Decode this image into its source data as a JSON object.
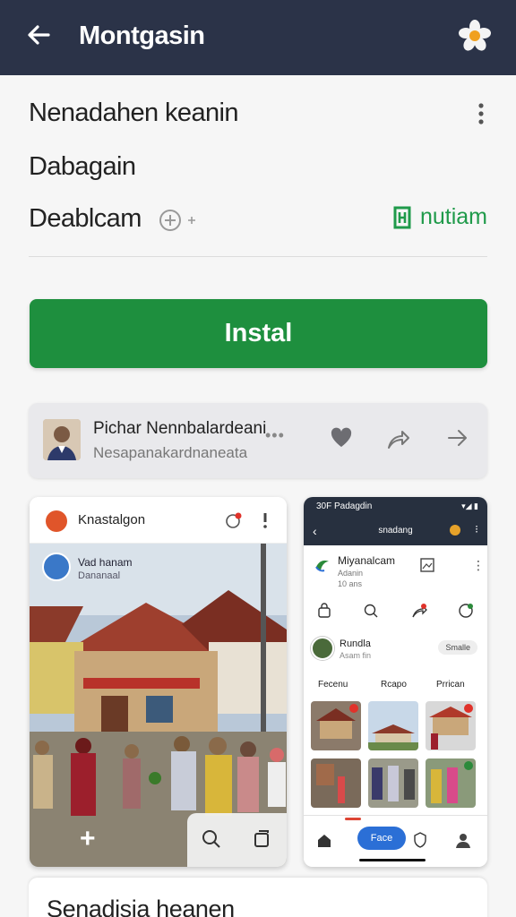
{
  "appbar": {
    "title": "Montgasin"
  },
  "info": {
    "line1": "Nenadahen keanin",
    "line2": "Dabagain",
    "line3": "Deablcam",
    "brand": "nutiam"
  },
  "install": {
    "label": "Instal"
  },
  "developer": {
    "name": "Pichar Nennbalardeani",
    "subtitle": "Nesapanakardnaneata",
    "dots": "•••"
  },
  "shot1": {
    "title": "Knastalgon",
    "post_user": "Vad hanam",
    "post_sub": "Dananaal",
    "plus": "+"
  },
  "shot2": {
    "status": "30F Padagdin",
    "nav": "snadang",
    "prof_name": "Miyanalcam",
    "prof_l2": "Adanin",
    "prof_l3": "10 ans",
    "user_name": "Rundla",
    "user_sub": "Asam fin",
    "follow": "Smalle",
    "tabs": [
      "Fecenu",
      "Rcapo",
      "Prrican"
    ],
    "pill": "Face"
  },
  "about": {
    "heading": "Senadisia heanen"
  },
  "colors": {
    "appbar": "#2b3348",
    "install": "#1e8f3e",
    "brand": "#1f9a4a"
  }
}
